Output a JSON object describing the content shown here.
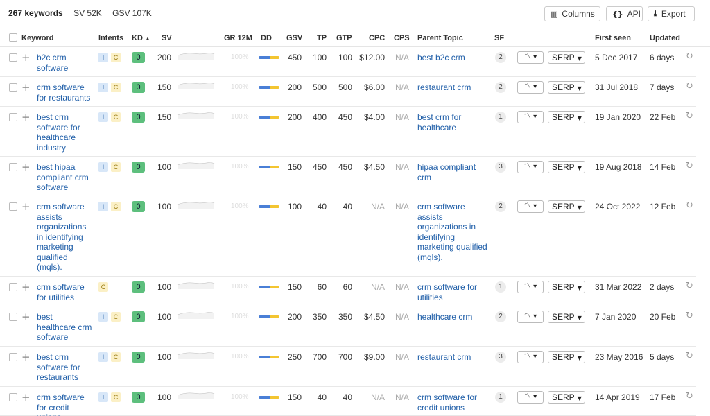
{
  "summary": {
    "keywords": "267 keywords",
    "sv": "SV 52K",
    "gsv": "GSV 107K"
  },
  "toolbar": {
    "columns_label": "Columns",
    "api_label": "API",
    "export_label": "Export"
  },
  "columns": {
    "keyword": "Keyword",
    "intents": "Intents",
    "kd": "KD",
    "sv": "SV",
    "gr": "GR 12M",
    "dd": "DD",
    "gsv": "GSV",
    "tp": "TP",
    "gtp": "GTP",
    "cpc": "CPC",
    "cps": "CPS",
    "parent_topic": "Parent Topic",
    "sf": "SF",
    "first_seen": "First seen",
    "updated": "Updated"
  },
  "sort_indicator": "▲",
  "intent_labels": {
    "i": "I",
    "c": "C"
  },
  "serp_label": "SERP",
  "gr_placeholder": "100%",
  "rows": [
    {
      "keyword": [
        "b2c crm",
        "software"
      ],
      "i": true,
      "c": true,
      "kd": "0",
      "sv": "200",
      "gsv": "450",
      "tp": "100",
      "gtp": "100",
      "cpc": "$12.00",
      "cps": "N/A",
      "parent": [
        "best b2c crm"
      ],
      "sf": "2",
      "first_seen": "5 Dec 2017",
      "updated": "6 days"
    },
    {
      "keyword": [
        "crm software",
        "for restaurants"
      ],
      "i": true,
      "c": true,
      "kd": "0",
      "sv": "150",
      "gsv": "200",
      "tp": "500",
      "gtp": "500",
      "cpc": "$6.00",
      "cps": "N/A",
      "parent": [
        "restaurant crm"
      ],
      "sf": "2",
      "first_seen": "31 Jul 2018",
      "updated": "7 days"
    },
    {
      "keyword": [
        "best crm",
        "software for",
        "healthcare",
        "industry"
      ],
      "i": true,
      "c": true,
      "kd": "0",
      "sv": "150",
      "gsv": "200",
      "tp": "400",
      "gtp": "450",
      "cpc": "$4.00",
      "cps": "N/A",
      "parent": [
        "best crm for",
        "healthcare"
      ],
      "sf": "1",
      "first_seen": "19 Jan 2020",
      "updated": "22 Feb"
    },
    {
      "keyword": [
        "best hipaa",
        "compliant crm",
        "software"
      ],
      "i": true,
      "c": true,
      "kd": "0",
      "sv": "100",
      "gsv": "150",
      "tp": "450",
      "gtp": "450",
      "cpc": "$4.50",
      "cps": "N/A",
      "parent": [
        "hipaa compliant",
        "crm"
      ],
      "sf": "3",
      "first_seen": "19 Aug 2018",
      "updated": "14 Feb"
    },
    {
      "keyword": [
        "crm software",
        "assists",
        "organizations",
        "in identifying",
        "marketing",
        "qualified",
        "(mqls)."
      ],
      "i": true,
      "c": true,
      "kd": "0",
      "sv": "100",
      "gsv": "100",
      "tp": "40",
      "gtp": "40",
      "cpc": "N/A",
      "cps": "N/A",
      "parent": [
        "crm software",
        "assists",
        "organizations in",
        "identifying",
        "marketing qualified",
        "(mqls)."
      ],
      "sf": "2",
      "first_seen": "24 Oct 2022",
      "updated": "12 Feb"
    },
    {
      "keyword": [
        "crm software",
        "for utilities"
      ],
      "i": false,
      "c": true,
      "kd": "0",
      "sv": "100",
      "gsv": "150",
      "tp": "60",
      "gtp": "60",
      "cpc": "N/A",
      "cps": "N/A",
      "parent": [
        "crm software for",
        "utilities"
      ],
      "sf": "1",
      "first_seen": "31 Mar 2022",
      "updated": "2 days"
    },
    {
      "keyword": [
        "best",
        "healthcare crm",
        "software"
      ],
      "i": true,
      "c": true,
      "kd": "0",
      "sv": "100",
      "gsv": "200",
      "tp": "350",
      "gtp": "350",
      "cpc": "$4.50",
      "cps": "N/A",
      "parent": [
        "healthcare crm"
      ],
      "sf": "2",
      "first_seen": "7 Jan 2020",
      "updated": "20 Feb"
    },
    {
      "keyword": [
        "best crm",
        "software for",
        "restaurants"
      ],
      "i": true,
      "c": true,
      "kd": "0",
      "sv": "100",
      "gsv": "250",
      "tp": "700",
      "gtp": "700",
      "cpc": "$9.00",
      "cps": "N/A",
      "parent": [
        "restaurant crm"
      ],
      "sf": "3",
      "first_seen": "23 May 2016",
      "updated": "5 days"
    },
    {
      "keyword": [
        "crm software",
        "for credit",
        "unions"
      ],
      "i": true,
      "c": true,
      "kd": "0",
      "sv": "100",
      "gsv": "150",
      "tp": "40",
      "gtp": "40",
      "cpc": "N/A",
      "cps": "N/A",
      "parent": [
        "crm software for",
        "credit unions"
      ],
      "sf": "1",
      "first_seen": "14 Apr 2019",
      "updated": "17 Feb"
    }
  ]
}
